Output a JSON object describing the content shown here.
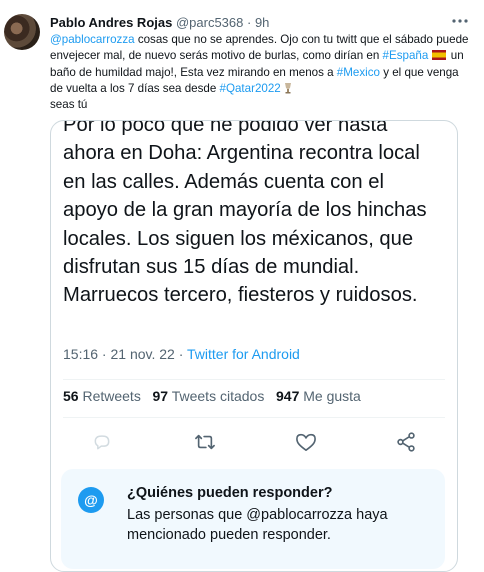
{
  "tweet": {
    "author_name": "Pablo Andres Rojas",
    "author_handle": "@parc5368",
    "separator": "·",
    "time_ago": "9h",
    "text_parts": {
      "mention": "@pablocarrozza",
      "t1": " cosas que no se aprendes. Ojo con tu twitt que el sábado puede envejecer mal, de nuevo serás motivo de burlas, como dirían en ",
      "hashtag_espana": "#España",
      "t2": " un baño de humildad majo!, Esta vez mirando en menos a ",
      "hashtag_mexico": "#Mexico",
      "t3": " y el que venga de vuelta a los 7 días sea desde ",
      "hashtag_qatar": "#Qatar2022",
      "t4": " seas tú"
    }
  },
  "quoted": {
    "text": "Por lo poco que he podido ver hasta ahora en Doha: Argentina recontra local en las calles. Además cuenta con el apoyo de la gran mayoría de los hinchas locales. Los siguen los méxicanos, que disfrutan sus 15 días de mundial. Marruecos tercero, fiesteros y ruidosos.",
    "time": "15:16 · 21 nov. 22 · ",
    "source": "Twitter for Android",
    "stats": {
      "retweets_count": "56",
      "retweets_label": " Retweets",
      "quotes_count": "97",
      "quotes_label": " Tweets citados",
      "likes_count": "947",
      "likes_label": " Me gusta"
    },
    "reply_info": {
      "icon": "@",
      "title": "¿Quiénes pueden responder?",
      "description": "Las personas que @pablocarrozza haya mencionado pueden responder."
    }
  },
  "icons": {
    "more": "more-horizontal-icon",
    "reply": "reply-icon",
    "retweet": "retweet-icon",
    "like": "heart-icon",
    "share": "share-icon"
  },
  "colors": {
    "accent": "#1d9bf0",
    "text": "#0f1419",
    "muted": "#536471",
    "reply_box_bg": "#f1f9fe"
  }
}
